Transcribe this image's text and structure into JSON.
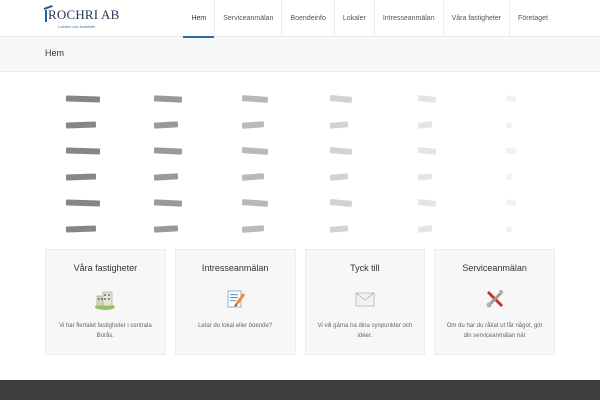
{
  "logo": {
    "text": "ROCHRI AB",
    "tagline": "Lokaler och bostäder"
  },
  "nav": {
    "items": [
      {
        "label": "Hem",
        "active": true
      },
      {
        "label": "Serviceanmälan",
        "active": false
      },
      {
        "label": "Boendeinfo",
        "active": false
      },
      {
        "label": "Lokaler",
        "active": false
      },
      {
        "label": "Intresseanmälan",
        "active": false
      },
      {
        "label": "Våra fastigheter",
        "active": false
      },
      {
        "label": "Företaget",
        "active": false
      }
    ],
    "accent_color": "#2b6aa6"
  },
  "page": {
    "title": "Hem"
  },
  "features": [
    {
      "title": "Våra fastigheter",
      "icon": "buildings-icon",
      "text": "Vi har flertalet fastigheter i centrala Borås."
    },
    {
      "title": "Intresseanmälan",
      "icon": "form-pencil-icon",
      "text": "Letar du lokal eller boende?"
    },
    {
      "title": "Tyck till",
      "icon": "envelope-icon",
      "text": "Vi vill gärna ha dina synpunkter och idéer."
    },
    {
      "title": "Serviceanmälan",
      "icon": "tools-icon",
      "text": "Om du har du råkat ut får något, gör din serviceanmälan här"
    }
  ]
}
